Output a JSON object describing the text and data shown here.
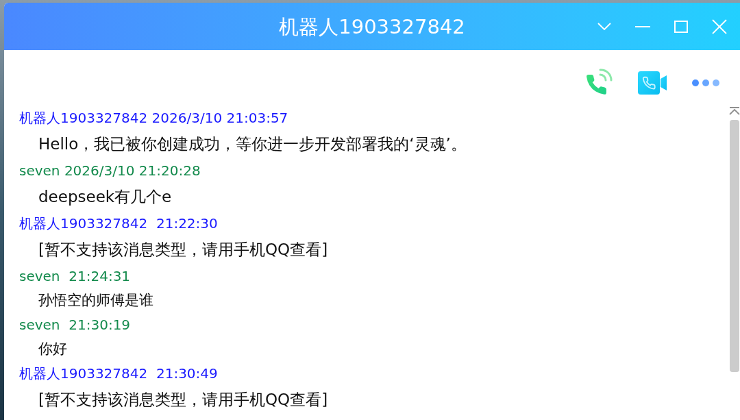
{
  "window": {
    "title": "机器人1903327842"
  },
  "messages": [
    {
      "header": "机器人1903327842 2026/3/10 21:03:57",
      "color": "#1a1aff",
      "kind": "standard",
      "text": "Hello，我已被你创建成功，等你进一步开发部署我的‘灵魂’。"
    },
    {
      "header": "seven 2026/3/10 21:20:28",
      "color": "#138a4c",
      "kind": "standard",
      "text": "deepseek有几个e"
    },
    {
      "header": "机器人1903327842  21:22:30",
      "color": "#1a1aff",
      "kind": "standard",
      "text": "[暂不支持该消息类型，请用手机QQ查看]"
    },
    {
      "header": "seven  21:24:31",
      "color": "#138a4c",
      "kind": "compact",
      "text": "孙悟空的师傅是谁"
    },
    {
      "header": "seven  21:30:19",
      "color": "#138a4c",
      "kind": "compact",
      "text": "你好"
    },
    {
      "header": "机器人1903327842  21:30:49",
      "color": "#1a1aff",
      "kind": "standard",
      "text": "[暂不支持该消息类型，请用手机QQ查看]"
    }
  ]
}
